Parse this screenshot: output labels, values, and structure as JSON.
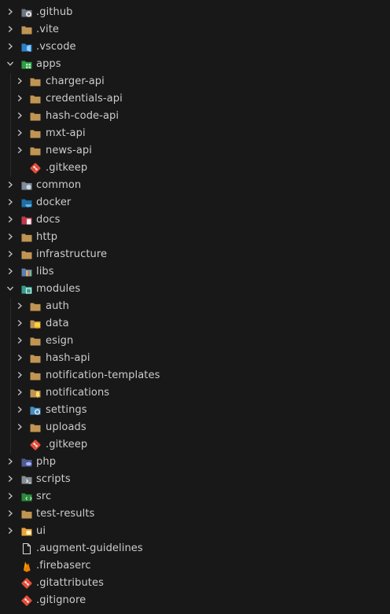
{
  "explorer": {
    "items": [
      {
        "label": ".github",
        "depth": 0,
        "type": "folder",
        "expanded": false,
        "icon": "github-folder-icon"
      },
      {
        "label": ".vite",
        "depth": 0,
        "type": "folder",
        "expanded": false,
        "icon": "folder-icon"
      },
      {
        "label": ".vscode",
        "depth": 0,
        "type": "folder",
        "expanded": false,
        "icon": "vscode-folder-icon"
      },
      {
        "label": "apps",
        "depth": 0,
        "type": "folder",
        "expanded": true,
        "icon": "apps-folder-icon"
      },
      {
        "label": "charger-api",
        "depth": 1,
        "type": "folder",
        "expanded": false,
        "icon": "folder-icon"
      },
      {
        "label": "credentials-api",
        "depth": 1,
        "type": "folder",
        "expanded": false,
        "icon": "folder-icon"
      },
      {
        "label": "hash-code-api",
        "depth": 1,
        "type": "folder",
        "expanded": false,
        "icon": "folder-icon"
      },
      {
        "label": "mxt-api",
        "depth": 1,
        "type": "folder",
        "expanded": false,
        "icon": "folder-icon"
      },
      {
        "label": "news-api",
        "depth": 1,
        "type": "folder",
        "expanded": false,
        "icon": "folder-icon"
      },
      {
        "label": ".gitkeep",
        "depth": 1,
        "type": "file",
        "icon": "git-file-icon"
      },
      {
        "label": "common",
        "depth": 0,
        "type": "folder",
        "expanded": false,
        "icon": "common-folder-icon"
      },
      {
        "label": "docker",
        "depth": 0,
        "type": "folder",
        "expanded": false,
        "icon": "docker-folder-icon"
      },
      {
        "label": "docs",
        "depth": 0,
        "type": "folder",
        "expanded": false,
        "icon": "docs-folder-icon"
      },
      {
        "label": "http",
        "depth": 0,
        "type": "folder",
        "expanded": false,
        "icon": "folder-icon"
      },
      {
        "label": "infrastructure",
        "depth": 0,
        "type": "folder",
        "expanded": false,
        "icon": "folder-icon"
      },
      {
        "label": "libs",
        "depth": 0,
        "type": "folder",
        "expanded": false,
        "icon": "libs-folder-icon"
      },
      {
        "label": "modules",
        "depth": 0,
        "type": "folder",
        "expanded": true,
        "icon": "modules-folder-icon"
      },
      {
        "label": "auth",
        "depth": 1,
        "type": "folder",
        "expanded": false,
        "icon": "folder-icon"
      },
      {
        "label": "data",
        "depth": 1,
        "type": "folder",
        "expanded": false,
        "icon": "database-folder-icon"
      },
      {
        "label": "esign",
        "depth": 1,
        "type": "folder",
        "expanded": false,
        "icon": "folder-icon"
      },
      {
        "label": "hash-api",
        "depth": 1,
        "type": "folder",
        "expanded": false,
        "icon": "folder-icon"
      },
      {
        "label": "notification-templates",
        "depth": 1,
        "type": "folder",
        "expanded": false,
        "icon": "folder-icon"
      },
      {
        "label": "notifications",
        "depth": 1,
        "type": "folder",
        "expanded": false,
        "icon": "notifications-folder-icon"
      },
      {
        "label": "settings",
        "depth": 1,
        "type": "folder",
        "expanded": false,
        "icon": "settings-folder-icon"
      },
      {
        "label": "uploads",
        "depth": 1,
        "type": "folder",
        "expanded": false,
        "icon": "folder-icon"
      },
      {
        "label": ".gitkeep",
        "depth": 1,
        "type": "file",
        "icon": "git-file-icon"
      },
      {
        "label": "php",
        "depth": 0,
        "type": "folder",
        "expanded": false,
        "icon": "php-folder-icon"
      },
      {
        "label": "scripts",
        "depth": 0,
        "type": "folder",
        "expanded": false,
        "icon": "scripts-folder-icon"
      },
      {
        "label": "src",
        "depth": 0,
        "type": "folder",
        "expanded": false,
        "icon": "src-folder-icon"
      },
      {
        "label": "test-results",
        "depth": 0,
        "type": "folder",
        "expanded": false,
        "icon": "folder-icon"
      },
      {
        "label": "ui",
        "depth": 0,
        "type": "folder",
        "expanded": false,
        "icon": "ui-folder-icon"
      },
      {
        "label": ".augment-guidelines",
        "depth": 0,
        "type": "file",
        "icon": "file-icon"
      },
      {
        "label": ".firebaserc",
        "depth": 0,
        "type": "file",
        "icon": "firebase-icon"
      },
      {
        "label": ".gitattributes",
        "depth": 0,
        "type": "file",
        "icon": "git-file-icon"
      },
      {
        "label": ".gitignore",
        "depth": 0,
        "type": "file",
        "icon": "git-file-icon"
      }
    ]
  },
  "colors": {
    "background": "#181818",
    "text": "#cccccc",
    "chevron": "#c5c5c5",
    "folder": "#c09553",
    "git": "#e44d3a"
  }
}
